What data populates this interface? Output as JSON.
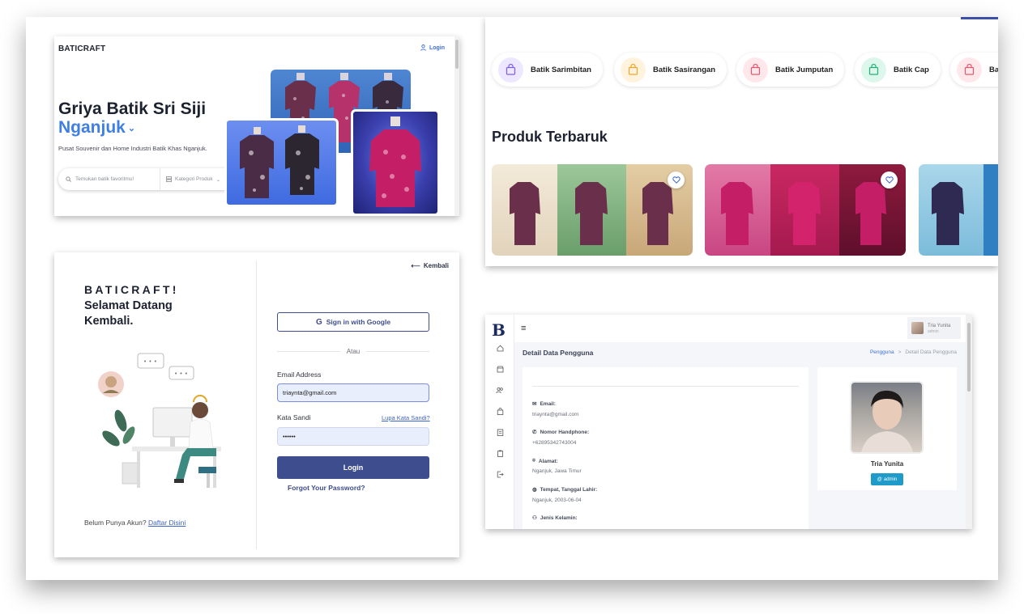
{
  "hero": {
    "brand": "BATICRAFT",
    "login_label": "Login",
    "title_line1": "Griya Batik Sri Siji",
    "title_line2": "Nganjuk",
    "subtitle": "Pusat Souvenir dan Home Industri Batik Khas Nganjuk.",
    "search_placeholder": "Temukan batik favoritmu!",
    "category_label": "Kategori Produk"
  },
  "catalog": {
    "categories": [
      {
        "label": "Batik Sarimbitan",
        "color": "#7c5cf0",
        "bg": "#ede8ff"
      },
      {
        "label": "Batik Sasirangan",
        "color": "#f0a52a",
        "bg": "#fff3dd"
      },
      {
        "label": "Batik Jumputan",
        "color": "#e5566d",
        "bg": "#ffe8ec"
      },
      {
        "label": "Batik Cap",
        "color": "#1fb37b",
        "bg": "#ddf7ec"
      },
      {
        "label": "Bati",
        "color": "#e5566d",
        "bg": "#ffe8ec"
      }
    ],
    "section_title": "Produk Terbaruk"
  },
  "login": {
    "back_label": "Kembali",
    "brand": "BATICRAFT!",
    "welcome": "Selamat Datang Kembali.",
    "google_label": "Sign in with Google",
    "or_label": "Atau",
    "email_label": "Email Address",
    "email_value": "triaynta@gmail.com",
    "password_label": "Kata Sandi",
    "forgot_link": "Lupa Kata Sandi?",
    "password_value": "••••••",
    "login_button": "Login",
    "forgot_password": "Forgot Your Password?",
    "signup_text": "Belum Punya Akun?",
    "signup_link": "Daftar Disini"
  },
  "admin": {
    "logo": "B",
    "user_name": "Tria Yunita",
    "user_role": "admin",
    "page_title": "Detail Data Pengguna",
    "breadcrumb": [
      "Pengguna",
      "Detail Data Pengguna"
    ],
    "breadcrumb_sep": ">",
    "fields": [
      {
        "icon": "✉",
        "label": "Email:",
        "value": "triaynta@gmail.com"
      },
      {
        "icon": "✆",
        "label": "Nomor Handphone:",
        "value": "+62895342743004"
      },
      {
        "icon": "⌾",
        "label": "Alamat:",
        "value": "Nganjuk, Jawa Timur"
      },
      {
        "icon": "◍",
        "label": "Tempat, Tanggal Lahir:",
        "value": "Nganjuk, 2003-06-04"
      },
      {
        "icon": "⚇",
        "label": "Jenis Kelamin:",
        "value": ""
      }
    ],
    "profile_name": "Tria Yunita",
    "profile_badge": "admin"
  }
}
